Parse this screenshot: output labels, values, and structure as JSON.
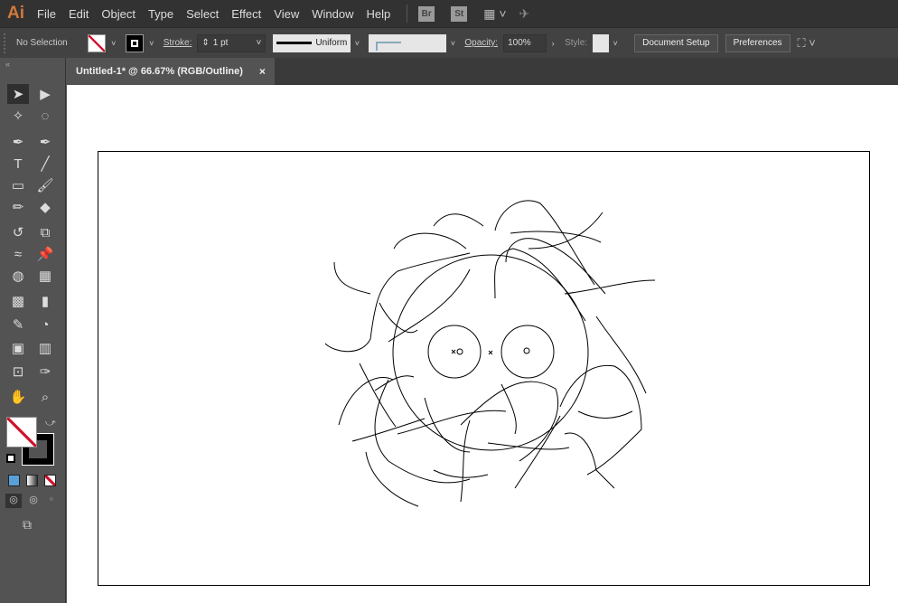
{
  "app": {
    "logo": "Ai"
  },
  "menu": [
    "File",
    "Edit",
    "Object",
    "Type",
    "Select",
    "Effect",
    "View",
    "Window",
    "Help"
  ],
  "app_buttons": [
    "Br",
    "St"
  ],
  "control": {
    "selection": "No Selection",
    "stroke_label": "Stroke:",
    "stroke_weight": "1 pt",
    "profile": "Uniform",
    "opacity_label": "Opacity:",
    "opacity": "100%",
    "style_label": "Style:",
    "document_setup": "Document Setup",
    "preferences": "Preferences"
  },
  "tab": {
    "title": "Untitled-1* @ 66.67% (RGB/Outline)",
    "close": "×"
  },
  "colors": {
    "accent": "#d07a3a",
    "fill_none_slash": "#d0102a",
    "color_mode": "#5aa0d8"
  },
  "tools": [
    "selection",
    "direct-selection",
    "magic-wand",
    "lasso",
    "pen",
    "curvature",
    "type",
    "line-segment",
    "rectangle",
    "paintbrush",
    "pencil",
    "eraser",
    "rotate",
    "scale",
    "warp",
    "puppet-warp",
    "shape-builder",
    "perspective-grid",
    "mesh",
    "gradient",
    "eyedropper",
    "blend",
    "symbol-sprayer",
    "column-graph",
    "artboard",
    "slice",
    "hand",
    "zoom"
  ]
}
